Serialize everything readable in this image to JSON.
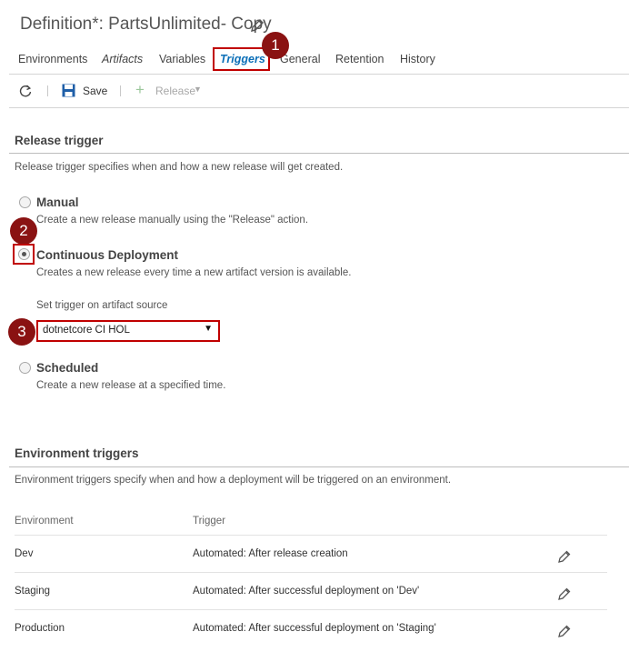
{
  "header": {
    "title": "Definition*: PartsUnlimited- Copy",
    "edit_icon": "pencil-icon"
  },
  "tabs": [
    {
      "label": "Environments",
      "active": false
    },
    {
      "label": "Artifacts",
      "active": false
    },
    {
      "label": "Variables",
      "active": false
    },
    {
      "label": "Triggers",
      "active": true
    },
    {
      "label": "General",
      "active": false
    },
    {
      "label": "Retention",
      "active": false
    },
    {
      "label": "History",
      "active": false
    }
  ],
  "toolbar": {
    "refresh_icon": "refresh-icon",
    "save_label": "Save",
    "save_icon": "save-icon",
    "release_label": "Release",
    "release_icon": "plus-icon"
  },
  "callouts": {
    "one": "1",
    "two": "2",
    "three": "3"
  },
  "release_trigger": {
    "title": "Release trigger",
    "description": "Release trigger specifies when and how a new release will get created.",
    "options": [
      {
        "label": "Manual",
        "description": "Create a new release manually using the \"Release\" action.",
        "selected": false
      },
      {
        "label": "Continuous Deployment",
        "description": "Creates a new release every time a new artifact version is available.",
        "selected": true
      },
      {
        "label": "Scheduled",
        "description": "Create a new release at a specified time.",
        "selected": false
      }
    ],
    "artifact_source_label": "Set trigger on artifact source",
    "artifact_source_value": "dotnetcore CI HOL",
    "accent_color": "#c00000"
  },
  "environment_triggers": {
    "title": "Environment triggers",
    "description": "Environment triggers specify when and how a deployment will be triggered on an environment.",
    "columns": [
      "Environment",
      "Trigger"
    ],
    "rows": [
      {
        "environment": "Dev",
        "trigger": "Automated: After release creation"
      },
      {
        "environment": "Staging",
        "trigger": "Automated: After successful deployment on 'Dev'"
      },
      {
        "environment": "Production",
        "trigger": "Automated: After successful deployment on 'Staging'"
      }
    ]
  },
  "colors": {
    "active_tab": "#0b6fb8",
    "highlight_box": "#c00000",
    "badge": "#8a1212"
  }
}
